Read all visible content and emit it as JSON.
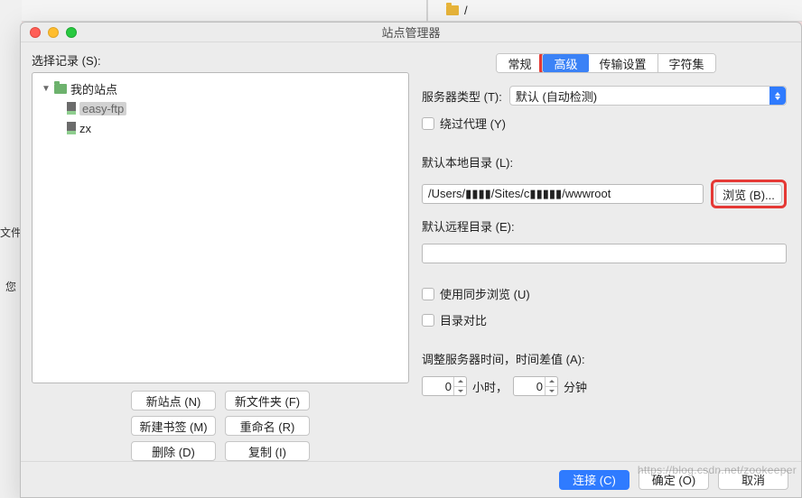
{
  "window": {
    "title": "站点管理器"
  },
  "sidebar": {
    "label": "选择记录 (S):",
    "root": {
      "label": "我的站点"
    },
    "items": [
      {
        "label": "easy-ftp",
        "selected": true
      },
      {
        "label": "zx",
        "selected": false
      }
    ],
    "buttons": {
      "new_site": "新站点 (N)",
      "new_folder": "新文件夹 (F)",
      "new_bookmark": "新建书签 (M)",
      "rename": "重命名 (R)",
      "delete": "删除 (D)",
      "copy": "复制 (I)"
    }
  },
  "tabs": [
    "常规",
    "高级",
    "传输设置",
    "字符集"
  ],
  "active_tab": "高级",
  "form": {
    "server_type_label": "服务器类型 (T):",
    "server_type_value": "默认 (自动检测)",
    "bypass_proxy": "绕过代理 (Y)",
    "local_dir_label": "默认本地目录 (L):",
    "local_dir_value": "/Users/▮▮▮▮/Sites/c▮▮▮▮▮/wwwroot",
    "browse_btn": "浏览 (B)...",
    "remote_dir_label": "默认远程目录 (E):",
    "remote_dir_value": "",
    "sync_browse": "使用同步浏览 (U)",
    "dir_compare": "目录对比",
    "time_label": "调整服务器时间，时间差值 (A):",
    "hours_value": "0",
    "hours_unit": "小时，",
    "minutes_value": "0",
    "minutes_unit": "分钟"
  },
  "footer": {
    "connect": "连接 (C)",
    "ok": "确定 (O)",
    "cancel": "取消"
  },
  "bg": {
    "wj": "文件",
    "yn": "您",
    "slash": "/"
  },
  "watermark": "https://blog.csdn.net/zookeeper"
}
